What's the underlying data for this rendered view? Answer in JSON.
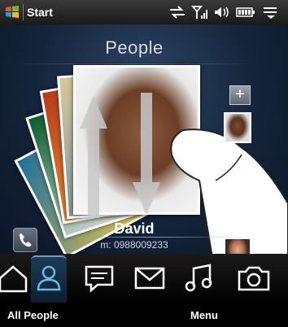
{
  "status_bar": {
    "start_label": "Start",
    "icons": [
      "sync-icon",
      "signal-icon",
      "speaker-icon",
      "battery-icon",
      "menu-icon"
    ]
  },
  "people": {
    "title": "People",
    "contact_name": "David",
    "contact_phone": "m: 0988009233",
    "add_label": "+"
  },
  "tabs": [
    {
      "name": "home",
      "icon": "home-icon"
    },
    {
      "name": "people",
      "icon": "person-icon",
      "active": true
    },
    {
      "name": "messages",
      "icon": "message-icon"
    },
    {
      "name": "mail",
      "icon": "mail-icon"
    },
    {
      "name": "music",
      "icon": "music-icon"
    },
    {
      "name": "photos",
      "icon": "camera-icon"
    }
  ],
  "softkeys": {
    "left": "All People",
    "right": "Menu"
  },
  "colors": {
    "accent": "#6a9ec8",
    "background": "#14243a"
  }
}
